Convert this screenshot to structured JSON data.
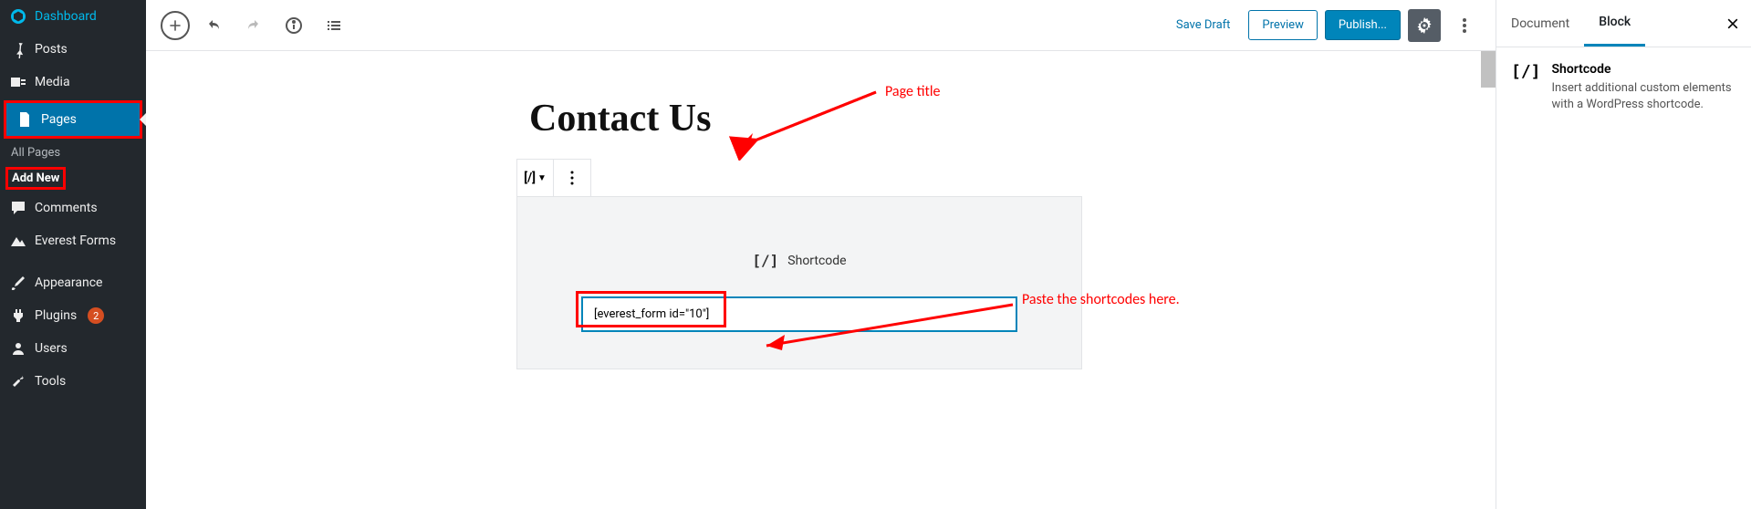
{
  "sidebar": {
    "items": [
      {
        "label": "Dashboard"
      },
      {
        "label": "Posts"
      },
      {
        "label": "Media"
      },
      {
        "label": "Pages"
      },
      {
        "label": "Comments"
      },
      {
        "label": "Everest Forms"
      },
      {
        "label": "Appearance"
      },
      {
        "label": "Plugins",
        "badge": "2"
      },
      {
        "label": "Users"
      },
      {
        "label": "Tools"
      }
    ],
    "submenu": [
      {
        "label": "All Pages"
      },
      {
        "label": "Add New"
      }
    ]
  },
  "toolbar": {
    "save_draft": "Save Draft",
    "preview": "Preview",
    "publish": "Publish..."
  },
  "editor": {
    "page_title": "Contact Us",
    "block_type_symbol": "[/]",
    "shortcode_label": "Shortcode",
    "shortcode_value": "[everest_form id=\"10\"]"
  },
  "annotations": {
    "title": "Page title",
    "paste": "Paste the shortcodes here."
  },
  "right_panel": {
    "tabs": [
      {
        "label": "Document"
      },
      {
        "label": "Block"
      }
    ],
    "block_symbol": "[/]",
    "block_title": "Shortcode",
    "block_desc": "Insert additional custom elements with a WordPress shortcode."
  }
}
